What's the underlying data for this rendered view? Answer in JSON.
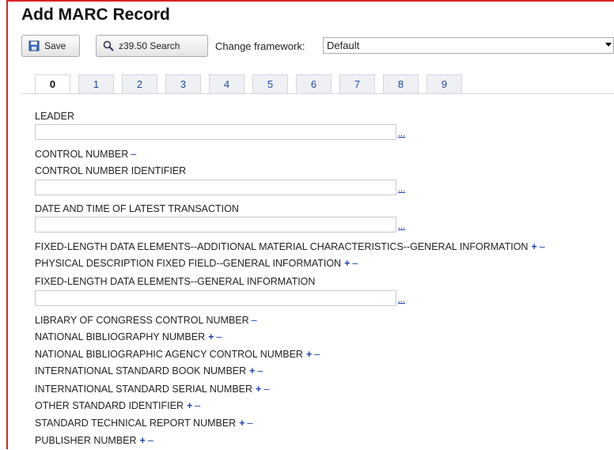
{
  "page": {
    "title": "Add MARC Record"
  },
  "toolbar": {
    "save_label": "Save",
    "search_label": "z39.50 Search",
    "framework_label": "Change framework:",
    "framework_value": "Default"
  },
  "tabs": [
    "0",
    "1",
    "2",
    "3",
    "4",
    "5",
    "6",
    "7",
    "8",
    "9"
  ],
  "active_tab": "0",
  "fields": {
    "leader": "LEADER",
    "control_number": "CONTROL NUMBER",
    "control_number_identifier": "CONTROL NUMBER IDENTIFIER",
    "date_time": "DATE AND TIME OF LATEST TRANSACTION",
    "fixed_additional": "FIXED-LENGTH DATA ELEMENTS--ADDITIONAL MATERIAL CHARACTERISTICS--GENERAL INFORMATION",
    "physical_description": "PHYSICAL DESCRIPTION FIXED FIELD--GENERAL INFORMATION",
    "fixed_general": "FIXED-LENGTH DATA ELEMENTS--GENERAL INFORMATION",
    "loc_control": "LIBRARY OF CONGRESS CONTROL NUMBER",
    "national_bib_number": "NATIONAL BIBLIOGRAPHY NUMBER",
    "national_bib_agency": "NATIONAL BIBLIOGRAPHIC AGENCY CONTROL NUMBER",
    "isbn": "INTERNATIONAL STANDARD BOOK NUMBER",
    "issn": "INTERNATIONAL STANDARD SERIAL NUMBER",
    "other_identifier": "OTHER STANDARD IDENTIFIER",
    "tech_report": "STANDARD TECHNICAL REPORT NUMBER",
    "publisher_number": "PUBLISHER NUMBER"
  },
  "controls": {
    "plus": "+",
    "minus": "–",
    "dots": "..."
  }
}
